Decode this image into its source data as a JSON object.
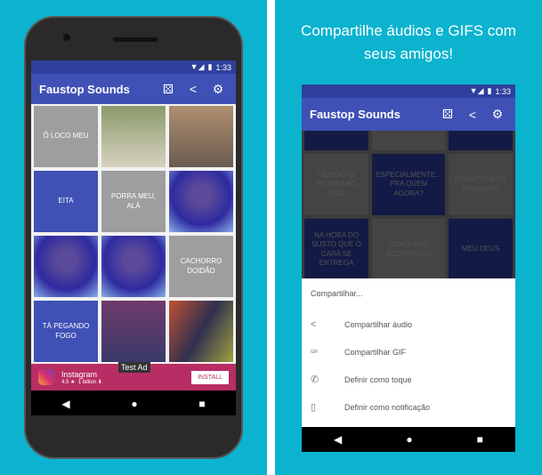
{
  "app": {
    "title": "Faustop Sounds",
    "time": "1:33",
    "icons": [
      "dice-icon",
      "share-icon",
      "settings-icon"
    ]
  },
  "left": {
    "tiles": [
      {
        "label": "Ô LOCO MEU",
        "style": "gray"
      },
      {
        "label": "",
        "style": "img1"
      },
      {
        "label": "",
        "style": "img2"
      },
      {
        "label": "EITA",
        "style": "blue"
      },
      {
        "label": "PORRA MEU, ALÁ",
        "style": "gray"
      },
      {
        "label": "",
        "style": "imgp"
      },
      {
        "label": "",
        "style": "imgp"
      },
      {
        "label": "",
        "style": "imgp"
      },
      {
        "label": "CACHORRO DOIDÃO",
        "style": "gray"
      },
      {
        "label": "TÁ PEGANDO FOGO",
        "style": "blue"
      },
      {
        "label": "",
        "style": "img3"
      },
      {
        "label": "",
        "style": "img4"
      }
    ],
    "ad": {
      "name": "Instagram",
      "rating": "4.5 ★",
      "downloads": "1 billion",
      "badge": "Test Ad",
      "install": "INSTALL"
    }
  },
  "caption": {
    "line1": "Compartilhe áudios e GIFS com",
    "line2": "seus amigos!"
  },
  "right": {
    "tiles": [
      {
        "label": "",
        "style": "db"
      },
      {
        "label": "",
        "style": "dg"
      },
      {
        "label": "",
        "style": "db"
      },
      {
        "label": "VIDEOCAS SETADA AO VIVO",
        "style": "dg"
      },
      {
        "label": "ESPECIALMENTE... PRA QUEM AGORA?",
        "style": "db"
      },
      {
        "label": "VOU ATRÁS DE POKEMON",
        "style": "dg"
      },
      {
        "label": "NA HORA DO SUSTO QUE O CARA SE ENTREGA",
        "style": "db"
      },
      {
        "label": "COMO ISSO ACONTECEU",
        "style": "dg"
      },
      {
        "label": "MEU DEUS",
        "style": "db"
      }
    ],
    "sheet": {
      "title": "Compartilhar...",
      "options": [
        {
          "label": "Compartilhar áudio",
          "icon": "share-icon",
          "glyph": "<"
        },
        {
          "label": "Compartilhar GIF",
          "icon": "gif-icon",
          "glyph": "GIF"
        },
        {
          "label": "Definir como toque",
          "icon": "ringtone-phone-icon",
          "glyph": "✆"
        },
        {
          "label": "Definir como notificação",
          "icon": "notification-phone-icon",
          "glyph": "▯"
        }
      ]
    }
  },
  "nav": {
    "back": "◀",
    "home": "●",
    "recents": "■"
  }
}
